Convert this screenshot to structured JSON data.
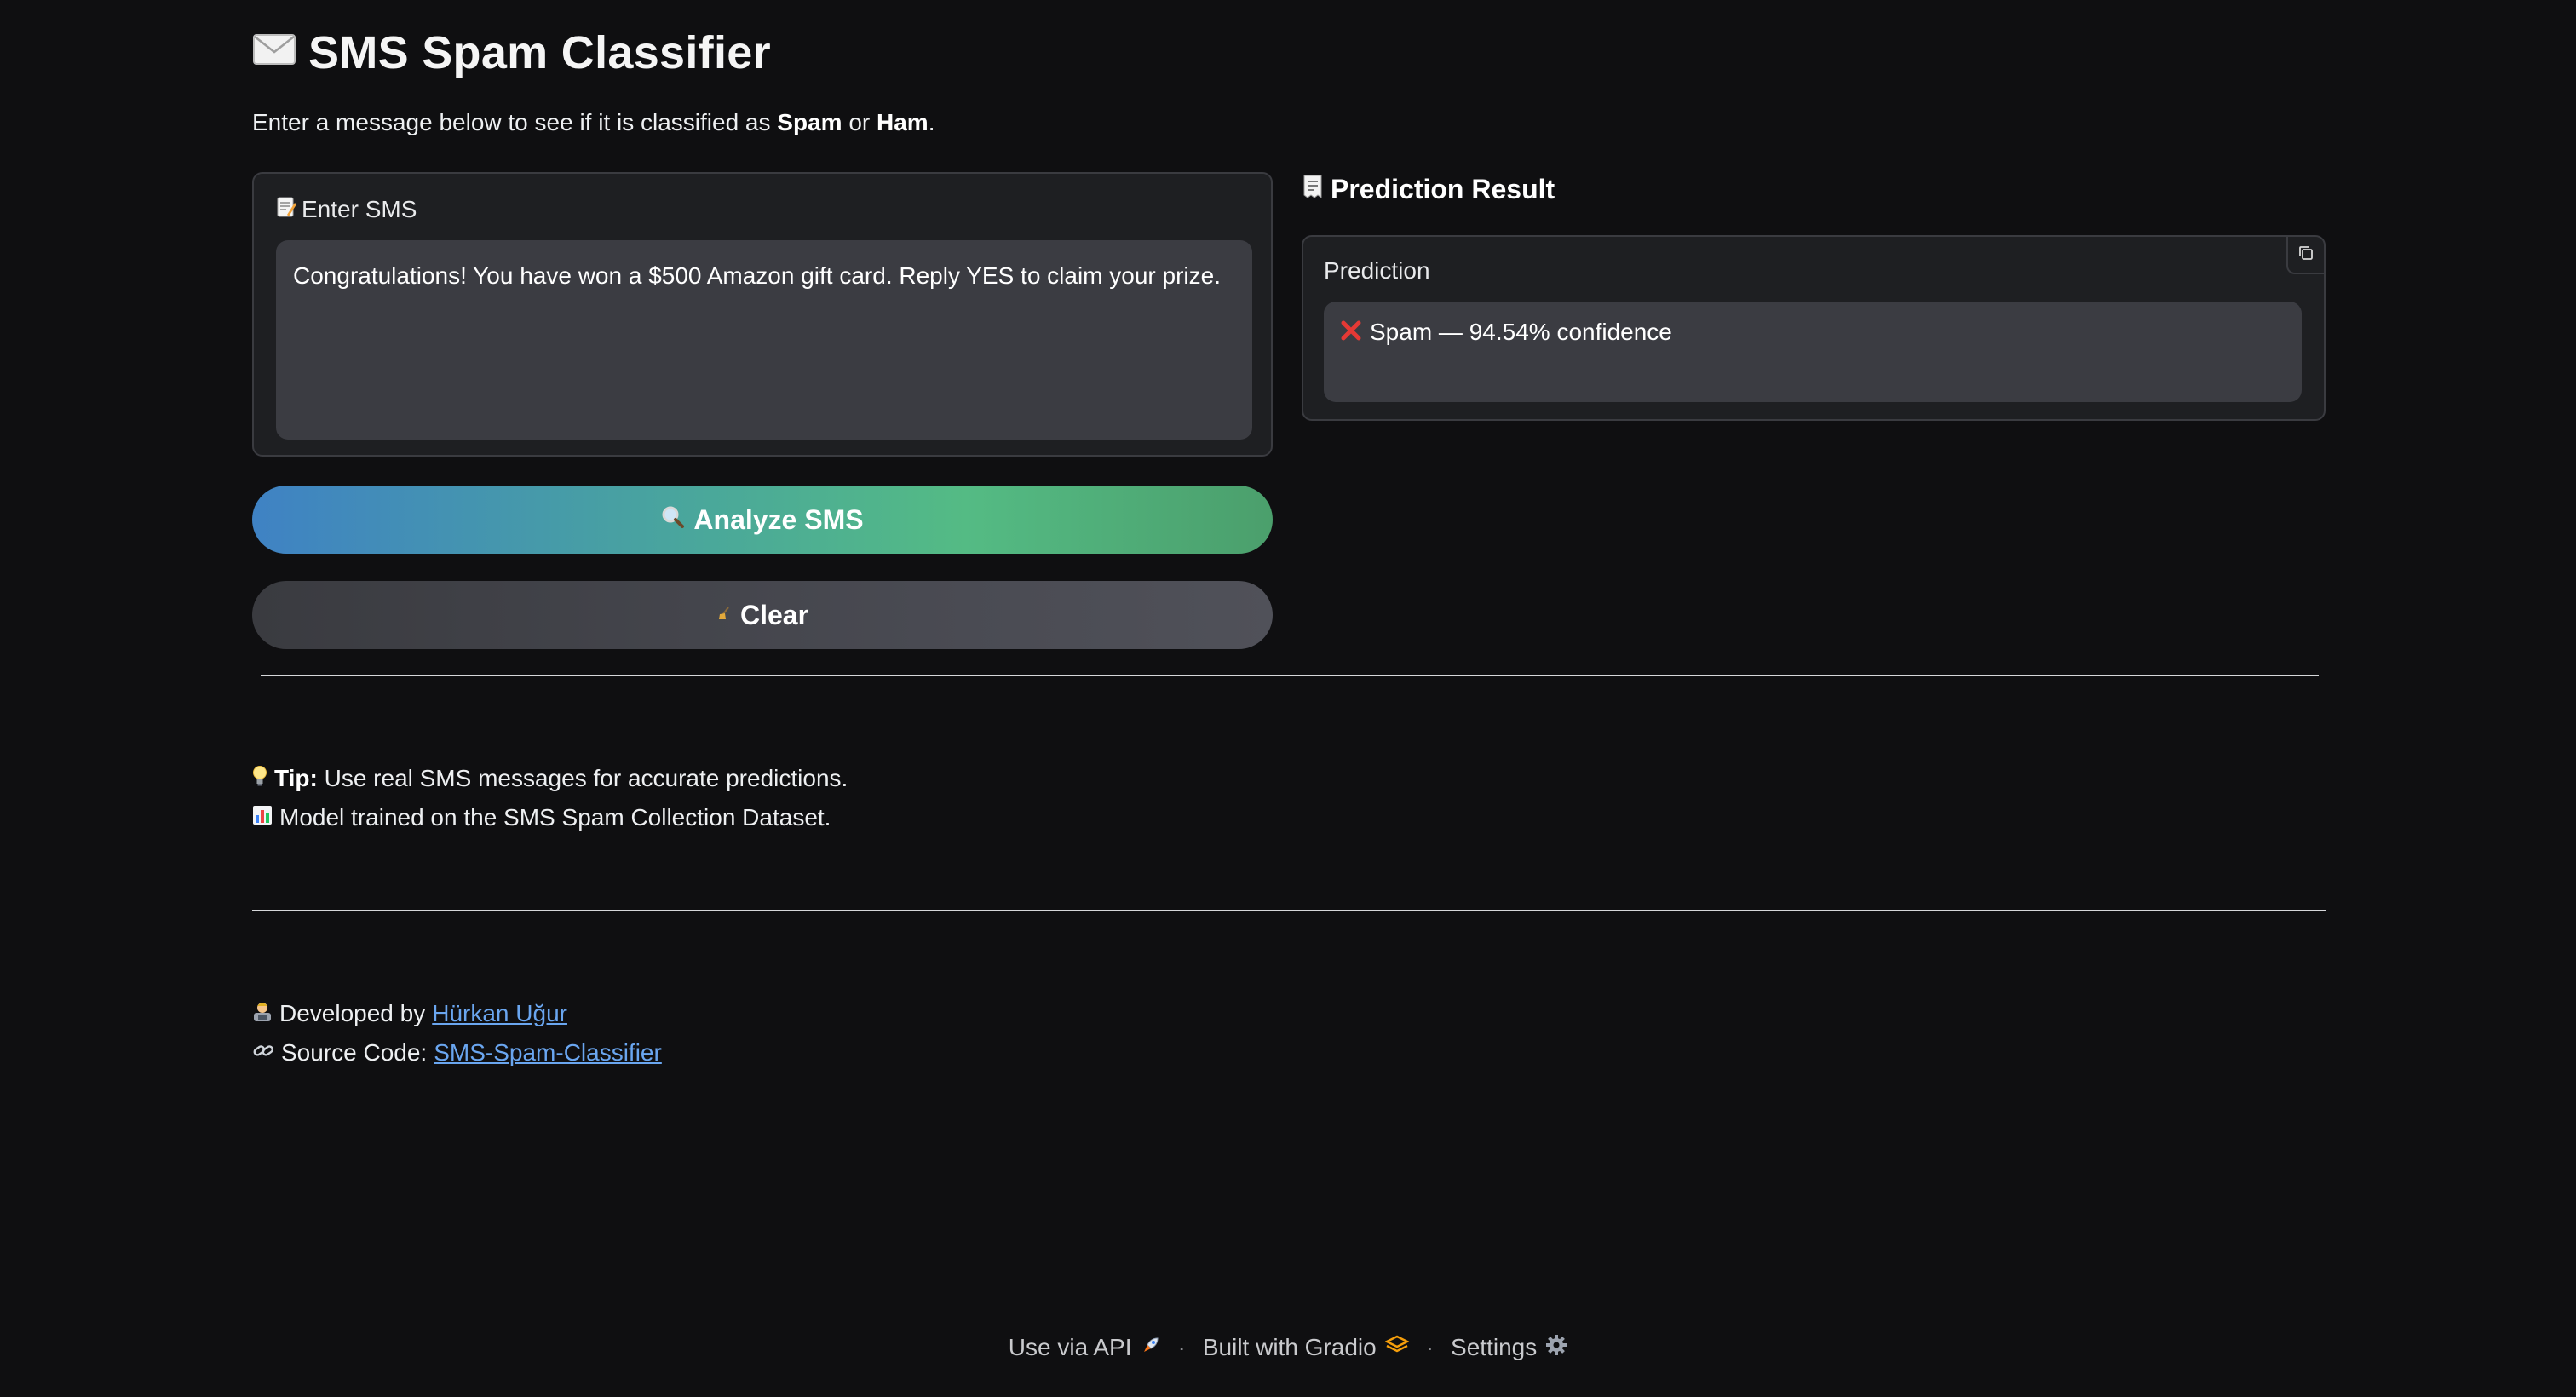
{
  "header": {
    "title_icon": "envelope-icon",
    "title": "SMS Spam Classifier",
    "subtitle_prefix": "Enter a message below to see if it is classified as ",
    "subtitle_spam": "Spam",
    "subtitle_or": " or ",
    "subtitle_ham": "Ham",
    "subtitle_suffix": "."
  },
  "input": {
    "label_icon": "memo-icon",
    "label": "Enter SMS",
    "value": "Congratulations! You have won a $500 Amazon gift card. Reply YES to claim your prize."
  },
  "buttons": {
    "analyze_icon": "magnifier-icon",
    "analyze_label": "Analyze SMS",
    "clear_icon": "broom-icon",
    "clear_label": "Clear"
  },
  "result": {
    "header_icon": "receipt-icon",
    "header": "Prediction Result",
    "label": "Prediction",
    "status_icon": "cross-mark-icon",
    "value": "Spam — 94.54% confidence",
    "copy_icon": "copy-icon"
  },
  "info": {
    "tip_icon": "lightbulb-icon",
    "tip_bold": "Tip:",
    "tip_text": "Use real SMS messages for accurate predictions.",
    "model_icon": "bar-chart-icon",
    "model_text": "Model trained on the SMS Spam Collection Dataset."
  },
  "credits": {
    "dev_icon": "developer-icon",
    "dev_prefix": "Developed by",
    "dev_name": "Hürkan Uğur",
    "source_icon": "link-icon",
    "source_prefix": "Source Code:",
    "source_name": "SMS-Spam-Classifier"
  },
  "footer": {
    "api_label": "Use via API",
    "api_icon": "rocket-icon",
    "built_label": "Built with Gradio",
    "built_icon": "gradio-logo-icon",
    "settings_label": "Settings",
    "settings_icon": "gear-icon",
    "separator": "·"
  },
  "colors": {
    "background": "#0f0f11",
    "panel": "#1e1f22",
    "input_bg": "#3b3c42",
    "link": "#6aa6f0",
    "spam_mark": "#e53935",
    "analyze_gradient_start": "#3f82c4",
    "analyze_gradient_end": "#4b9f6c"
  }
}
